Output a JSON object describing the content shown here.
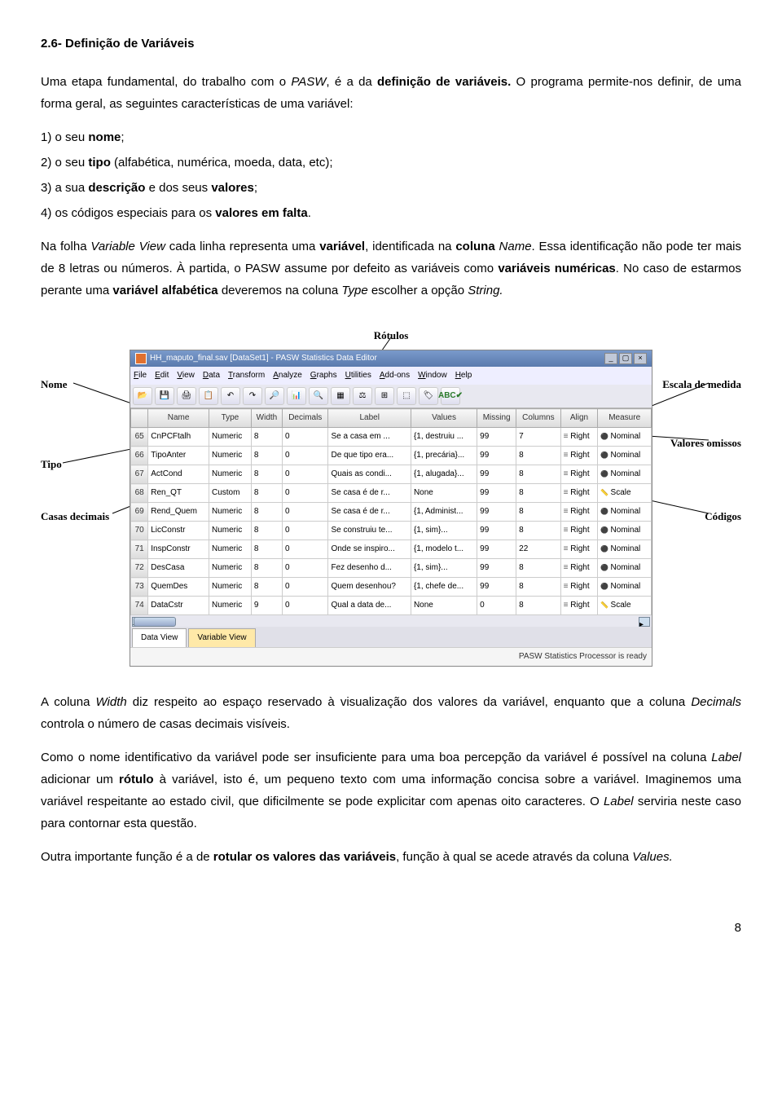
{
  "heading": "2.6- Definição de Variáveis",
  "p1a": "Uma etapa fundamental, do trabalho com o ",
  "p1b": "PASW",
  "p1c": ", é a da ",
  "p1d": "definição de variáveis.",
  "p1e": " O programa permite-nos definir, de uma forma geral, as seguintes características de uma variável:",
  "li1a": "1) o seu ",
  "li1b": "nome",
  "li1c": ";",
  "li2a": "2) o seu ",
  "li2b": "tipo",
  "li2c": " (alfabética, numérica, moeda, data, etc);",
  "li3a": "3) a sua ",
  "li3b": "descrição",
  "li3c": " e dos seus ",
  "li3d": "valores",
  "li3e": ";",
  "li4a": "4) os códigos especiais para os ",
  "li4b": "valores em falta",
  "li4c": ".",
  "p2a": "Na folha ",
  "p2b": "Variable View",
  "p2c": " cada linha representa uma ",
  "p2d": "variável",
  "p2e": ", identificada na ",
  "p2f": "coluna",
  "p2g": " Name",
  "p2h": ". Essa identificação não pode ter mais de 8 letras ou números. À partida, o PASW assume por defeito as variáveis como ",
  "p2i": "variáveis numéricas",
  "p2j": ". No caso de estarmos perante uma ",
  "p2k": "variável alfabética",
  "p2l": " deveremos na coluna ",
  "p2m": "Type",
  "p2n": "  escolher a opção ",
  "p2o": "String.",
  "anno": {
    "rotulos": "Rótulos",
    "nome": "Nome",
    "tipo": "Tipo",
    "casas": "Casas decimais",
    "escala": "Escala de medida",
    "omissos": "Valores omissos",
    "codigos": "Códigos"
  },
  "pasw": {
    "title": "HH_maputo_final.sav [DataSet1] - PASW Statistics Data Editor",
    "menu": [
      "File",
      "Edit",
      "View",
      "Data",
      "Transform",
      "Analyze",
      "Graphs",
      "Utilities",
      "Add-ons",
      "Window",
      "Help"
    ],
    "headers": [
      "",
      "Name",
      "Type",
      "Width",
      "Decimals",
      "Label",
      "Values",
      "Missing",
      "Columns",
      "Align",
      "Measure"
    ],
    "rows": [
      {
        "n": "65",
        "name": "CnPCFtalh",
        "type": "Numeric",
        "w": "8",
        "d": "0",
        "label": "Se a casa em ...",
        "values": "{1, destruiu ...",
        "miss": "99",
        "cols": "7",
        "align": "Right",
        "measure": "Nominal"
      },
      {
        "n": "66",
        "name": "TipoAnter",
        "type": "Numeric",
        "w": "8",
        "d": "0",
        "label": "De que tipo era...",
        "values": "{1, precária}...",
        "miss": "99",
        "cols": "8",
        "align": "Right",
        "measure": "Nominal"
      },
      {
        "n": "67",
        "name": "ActCond",
        "type": "Numeric",
        "w": "8",
        "d": "0",
        "label": "Quais as condi...",
        "values": "{1, alugada}...",
        "miss": "99",
        "cols": "8",
        "align": "Right",
        "measure": "Nominal"
      },
      {
        "n": "68",
        "name": "Ren_QT",
        "type": "Custom",
        "w": "8",
        "d": "0",
        "label": "Se casa é de r...",
        "values": "None",
        "miss": "99",
        "cols": "8",
        "align": "Right",
        "measure": "Scale"
      },
      {
        "n": "69",
        "name": "Rend_Quem",
        "type": "Numeric",
        "w": "8",
        "d": "0",
        "label": "Se casa é de r...",
        "values": "{1, Administ...",
        "miss": "99",
        "cols": "8",
        "align": "Right",
        "measure": "Nominal"
      },
      {
        "n": "70",
        "name": "LicConstr",
        "type": "Numeric",
        "w": "8",
        "d": "0",
        "label": "Se construiu te...",
        "values": "{1, sim}...",
        "miss": "99",
        "cols": "8",
        "align": "Right",
        "measure": "Nominal"
      },
      {
        "n": "71",
        "name": "InspConstr",
        "type": "Numeric",
        "w": "8",
        "d": "0",
        "label": "Onde se inspiro...",
        "values": "{1, modelo t...",
        "miss": "99",
        "cols": "22",
        "align": "Right",
        "measure": "Nominal"
      },
      {
        "n": "72",
        "name": "DesCasa",
        "type": "Numeric",
        "w": "8",
        "d": "0",
        "label": "Fez desenho d...",
        "values": "{1, sim}...",
        "miss": "99",
        "cols": "8",
        "align": "Right",
        "measure": "Nominal"
      },
      {
        "n": "73",
        "name": "QuemDes",
        "type": "Numeric",
        "w": "8",
        "d": "0",
        "label": "Quem desenhou?",
        "values": "{1, chefe de...",
        "miss": "99",
        "cols": "8",
        "align": "Right",
        "measure": "Nominal"
      },
      {
        "n": "74",
        "name": "DataCstr",
        "type": "Numeric",
        "w": "9",
        "d": "0",
        "label": "Qual a data de...",
        "values": "None",
        "miss": "0",
        "cols": "8",
        "align": "Right",
        "measure": "Scale"
      }
    ],
    "tabs": {
      "data": "Data View",
      "var": "Variable View"
    },
    "status": "PASW Statistics Processor is ready"
  },
  "p3a": "A coluna ",
  "p3b": "Width",
  "p3c": " diz respeito ao espaço reservado à visualização dos valores da variável, enquanto que a coluna ",
  "p3d": "Decimals",
  "p3e": " controla o número de casas decimais visíveis.",
  "p4a": "Como o nome identificativo da variável pode ser insuficiente para uma boa percepção da variável é possível na coluna ",
  "p4b": "Label",
  "p4c": " adicionar um ",
  "p4d": "rótulo",
  "p4e": " à variável, isto é, um pequeno texto com uma informação concisa sobre a variável. Imaginemos uma variável respeitante ao estado civil, que dificilmente se pode explicitar com apenas oito caracteres. O ",
  "p4f": "Label",
  "p4g": " serviria neste caso para contornar esta questão.",
  "p5a": " Outra importante função é a de ",
  "p5b": "rotular os valores das variáveis",
  "p5c": ", função à qual se acede através da coluna ",
  "p5d": "Values.",
  "page": "8"
}
